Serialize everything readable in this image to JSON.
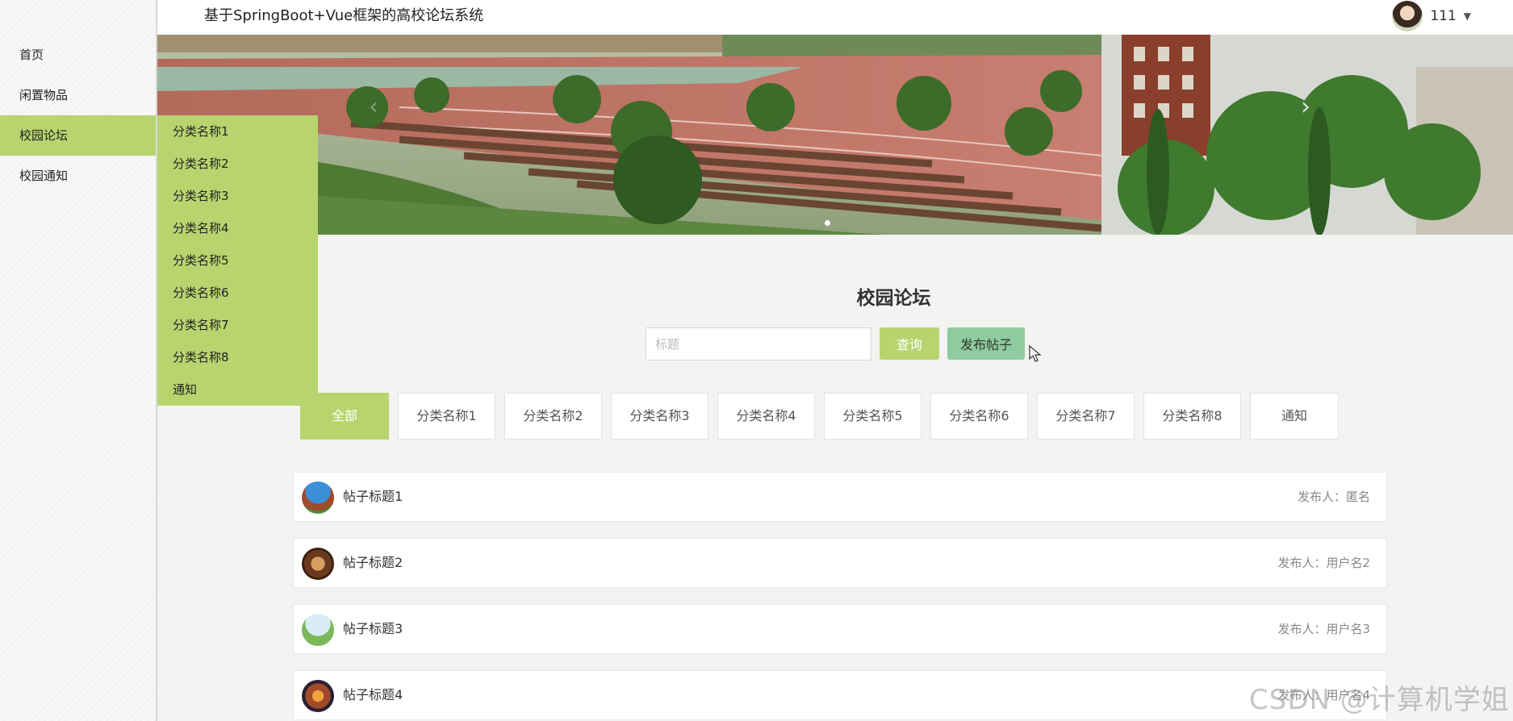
{
  "header": {
    "title": "基于SpringBoot+Vue框架的高校论坛系统",
    "username": "111"
  },
  "sidebar": {
    "items": [
      {
        "label": "首页"
      },
      {
        "label": "闲置物品"
      },
      {
        "label": "校园论坛"
      },
      {
        "label": "校园通知"
      }
    ]
  },
  "dropdown": {
    "items": [
      "分类名称1",
      "分类名称2",
      "分类名称3",
      "分类名称4",
      "分类名称5",
      "分类名称6",
      "分类名称7",
      "分类名称8",
      "通知"
    ]
  },
  "main": {
    "title": "校园论坛",
    "search_placeholder": "标题",
    "query_label": "查询",
    "post_label": "发布帖子",
    "tabs": [
      "全部",
      "分类名称1",
      "分类名称2",
      "分类名称3",
      "分类名称4",
      "分类名称5",
      "分类名称6",
      "分类名称7",
      "分类名称8",
      "通知"
    ],
    "posts": [
      {
        "title": "帖子标题1",
        "author": "发布人：匿名"
      },
      {
        "title": "帖子标题2",
        "author": "发布人：用户名2"
      },
      {
        "title": "帖子标题3",
        "author": "发布人：用户名3"
      },
      {
        "title": "帖子标题4",
        "author": "发布人：用户名4"
      }
    ]
  },
  "watermark": "CSDN @计算机学姐",
  "colors": {
    "accent": "#b8d46e",
    "post_button": "#8ecb9e"
  }
}
